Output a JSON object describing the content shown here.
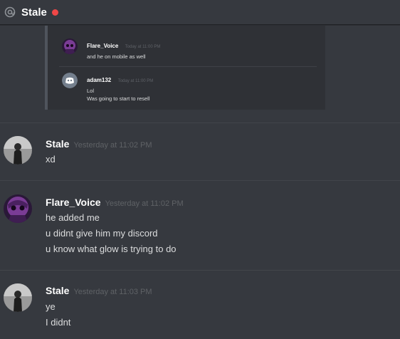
{
  "header": {
    "title": "Stale",
    "at_icon": "at-icon",
    "status_color": "#f04747"
  },
  "embed": {
    "messages": [
      {
        "author": "Flare_Voice",
        "timestamp": "Today at 11:00 PM",
        "lines": [
          "and he on mobile as well"
        ]
      },
      {
        "author": "adam132",
        "timestamp": "Today at 11:00 PM",
        "lines": [
          "Lol",
          "Was going to start to resell"
        ]
      }
    ]
  },
  "messages": [
    {
      "author": "Stale",
      "timestamp": "Yesterday at 11:02 PM",
      "lines": [
        "xd"
      ]
    },
    {
      "author": "Flare_Voice",
      "timestamp": "Yesterday at 11:02 PM",
      "lines": [
        "he added me",
        "u didnt give him my discord",
        "u know what glow is trying to do"
      ]
    },
    {
      "author": "Stale",
      "timestamp": "Yesterday at 11:03 PM",
      "lines": [
        "ye",
        "I didnt"
      ]
    }
  ]
}
